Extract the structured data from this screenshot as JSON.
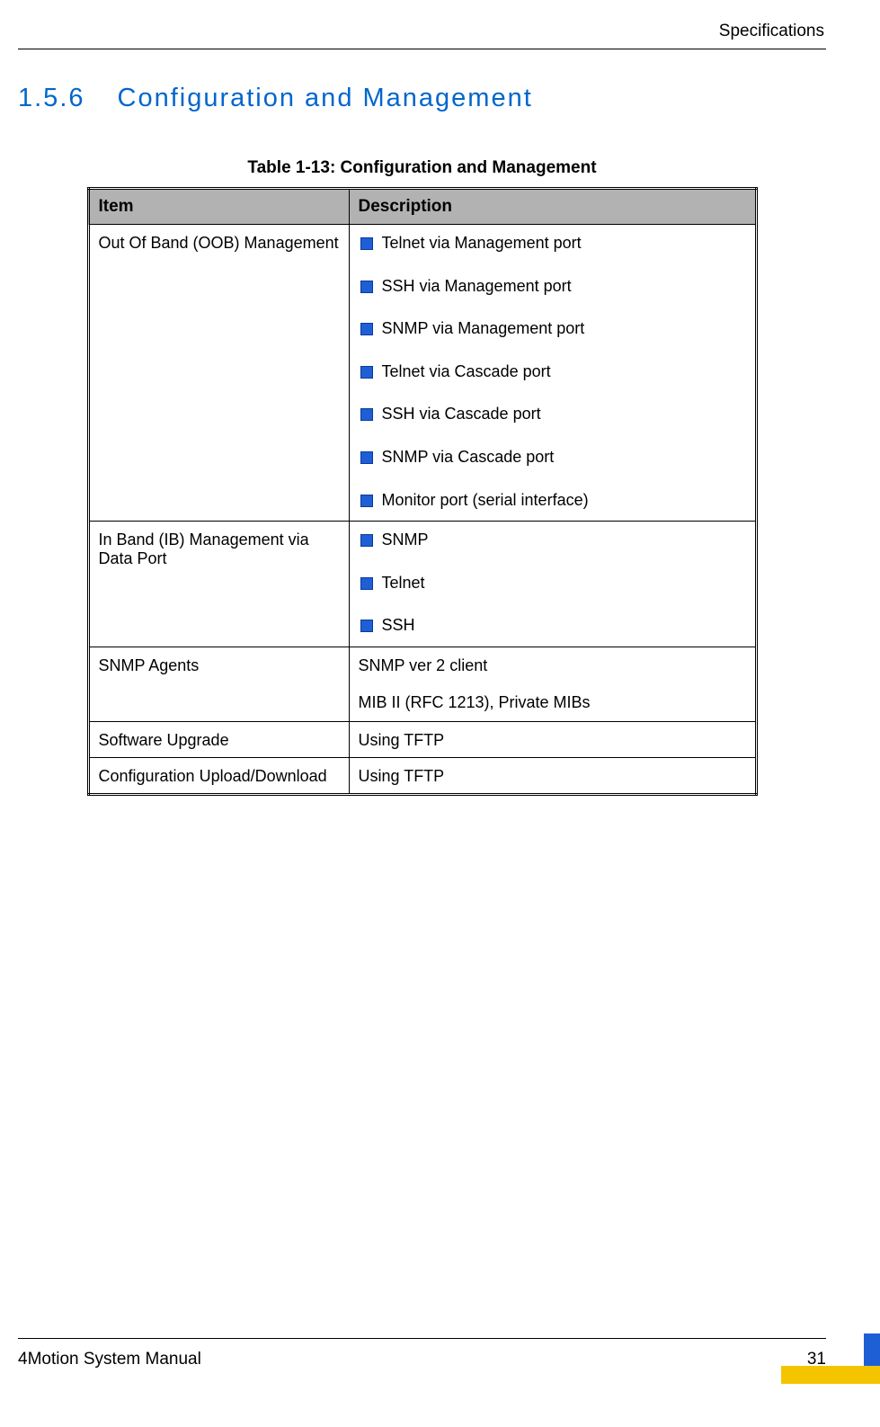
{
  "header": {
    "category": "Specifications"
  },
  "section": {
    "number": "1.5.6",
    "title": "Configuration and Management"
  },
  "table": {
    "caption": "Table 1-13: Configuration and Management",
    "headers": {
      "item": "Item",
      "description": "Description"
    },
    "rows": [
      {
        "item": "Out Of Band (OOB) Management",
        "description_type": "bullets",
        "bullets": [
          "Telnet via Management port",
          "SSH via Management port",
          "SNMP via Management port",
          "Telnet via Cascade port",
          "SSH via Cascade port",
          "SNMP via Cascade port",
          "Monitor port (serial interface)"
        ]
      },
      {
        "item": "In Band (IB) Management via Data Port",
        "description_type": "bullets",
        "bullets": [
          "SNMP",
          "Telnet",
          "SSH"
        ]
      },
      {
        "item": "SNMP Agents",
        "description_type": "lines",
        "lines": [
          "SNMP ver 2 client",
          "MIB II (RFC 1213), Private MIBs"
        ]
      },
      {
        "item": "Software Upgrade",
        "description_type": "text",
        "text": "Using TFTP"
      },
      {
        "item": "Configuration Upload/Download",
        "description_type": "text",
        "text": "Using TFTP"
      }
    ]
  },
  "footer": {
    "manual": "4Motion System Manual",
    "page": "31"
  }
}
